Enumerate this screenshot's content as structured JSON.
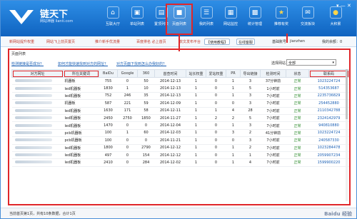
{
  "app": {
    "brand": "链天下",
    "subtitle": "网站神器 lianti.com"
  },
  "toolbar": {
    "items": [
      {
        "label": "互联大厅",
        "icon": "home-icon"
      },
      {
        "label": "单站列表",
        "icon": "monitor-icon"
      },
      {
        "label": "置顶列表",
        "icon": "document-icon"
      },
      {
        "label": "页面列表",
        "icon": "screen-icon"
      },
      {
        "label": "我的列表",
        "icon": "list-icon"
      },
      {
        "label": "网站监控",
        "icon": "chart-icon"
      },
      {
        "label": "统计管理",
        "icon": "grid-icon"
      },
      {
        "label": "推荐有奖",
        "icon": "star-icon"
      },
      {
        "label": "交流板块",
        "icon": "chat-icon"
      },
      {
        "label": "大积累",
        "icon": "coin-icon"
      }
    ],
    "window_controls": "▾ — ✕"
  },
  "infobar": {
    "links": [
      "新网站提升权重",
      "网站飞上前页置页",
      "推介新手优流量",
      "百度排名 必上首页",
      "软文发布平台"
    ],
    "chip": "【使用教程】",
    "online_label": "在线客服",
    "user_label": "基础账号",
    "user_value": "jianzhen",
    "balance": "我的余额：0"
  },
  "panel": {
    "title": "页面列表",
    "filter_links": [
      "检测链接是否成功？",
      "如何才能快速找到对方的网址？",
      "对方页面下找到怎么办我好的？"
    ],
    "select_label": "选择网站：",
    "select_value": "全部"
  },
  "table": {
    "columns": [
      "对方网址",
      "所在关键词",
      "BaiDu",
      "Google",
      "360",
      "首查时间",
      "站长权重",
      "爱站权重",
      "PR",
      "导出链接",
      "检测时间",
      "状态",
      "联系码"
    ],
    "rows": [
      [
        "",
        "机器板",
        "755",
        "0",
        "50",
        "2014-12-13",
        "1",
        "0",
        "1",
        "3",
        "37分钟前",
        "正常",
        "1023224724"
      ],
      [
        "",
        "led机器板",
        "1830",
        "1",
        "10",
        "2014-12-13",
        "1",
        "0",
        "1",
        "5",
        "1小时前",
        "正常",
        "514353687"
      ],
      [
        "",
        "led机器板",
        "752",
        "246",
        "35",
        "2014-12-13",
        "1",
        "0",
        "1",
        "3",
        "7小时前",
        "正常",
        "2235736829"
      ],
      [
        "",
        "机器板",
        "587",
        "221",
        "59",
        "2014-12-09",
        "1",
        "0",
        "0",
        "3",
        "7小时前",
        "正常",
        "254452880"
      ],
      [
        "",
        "led机器板",
        "1630",
        "171",
        "58",
        "2014-12-11",
        "1",
        "1",
        "4",
        "28",
        "7小时前",
        "正常",
        "2110342788"
      ],
      [
        "",
        "led机器板",
        "2450",
        "2750",
        "1850",
        "2014-11-27",
        "1",
        "2",
        "2",
        "5",
        "7小时前",
        "正常",
        "2324142979"
      ],
      [
        "",
        "led机器板",
        "1470",
        "0",
        "0",
        "2014-12-04",
        "1",
        "0",
        "1",
        "3",
        "7小时前",
        "正常",
        "940810880"
      ],
      [
        "",
        "pcb机器板",
        "100",
        "1",
        "60",
        "2014-12-03",
        "1",
        "0",
        "3",
        "2",
        "41分钟前",
        "正常",
        "1023224724"
      ],
      [
        "",
        "pcb机器板",
        "100",
        "0",
        "0",
        "2014-11-21",
        "1",
        "0",
        "0",
        "3",
        "7小时前",
        "正常",
        "240587330"
      ],
      [
        "",
        "led机器板",
        "1800",
        "0",
        "2790",
        "2014-12-12",
        "1",
        "0",
        "1",
        "2",
        "7小时前",
        "正常",
        "1023284478"
      ],
      [
        "",
        "led机器板",
        "497",
        "0",
        "154",
        "2014-12-12",
        "1",
        "0",
        "1",
        "1",
        "7小时前",
        "正常",
        "2059907234"
      ],
      [
        "",
        "led机器板",
        "2410",
        "0",
        "284",
        "2014-12-02",
        "1",
        "0",
        "1",
        "4",
        "7小时前",
        "正常",
        "1599900220"
      ]
    ]
  },
  "footer": {
    "text": "当前首页第1页，共有10条数据，合计1页",
    "watermark": "Baidu 经验"
  },
  "colors": {
    "accent": "#e0262a",
    "header": "#1673d0",
    "status_ok": "#2b8a2b",
    "link": "#1a5fb4"
  }
}
